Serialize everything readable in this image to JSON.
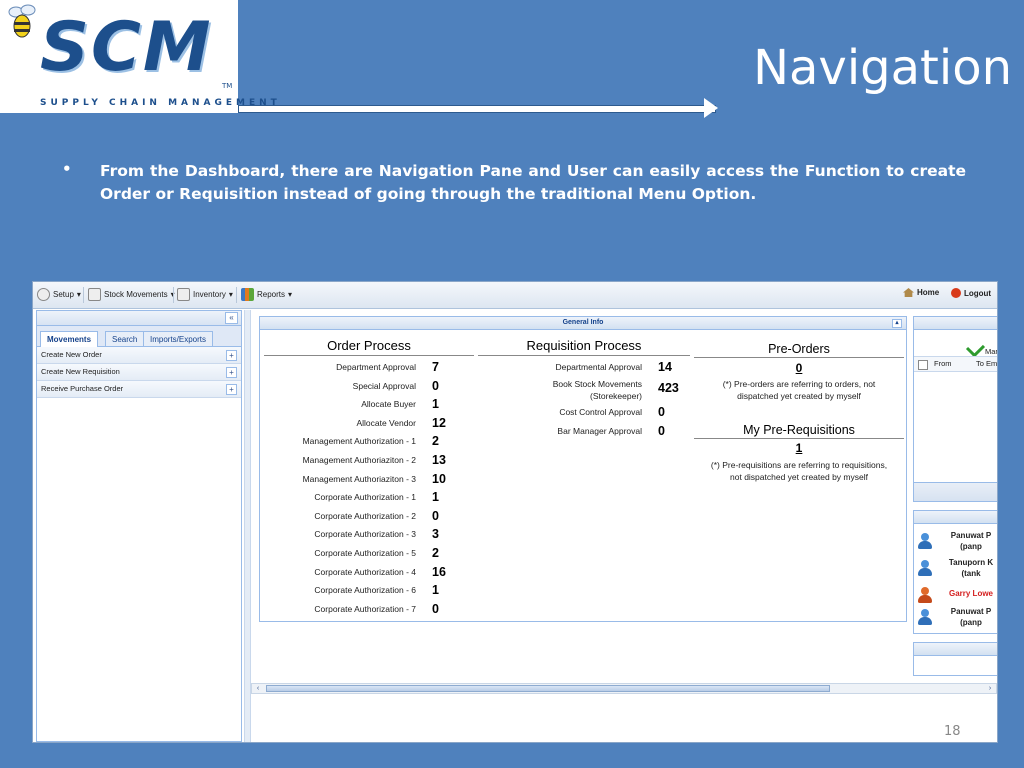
{
  "slide": {
    "title": "Navigation",
    "logo_text": "SCM",
    "logo_tagline": "SUPPLY CHAIN MANAGEMENT",
    "logo_tm": "TM",
    "bullet_mark": "•",
    "bullet_text": "From the Dashboard, there are Navigation Pane and User can easily access the Function to create Order or Requisition instead of going through the traditional Menu Option.",
    "page_number": "18"
  },
  "toolbar": {
    "setup": "Setup",
    "stock_movements": "Stock Movements",
    "inventory": "Inventory",
    "reports": "Reports",
    "home": "Home",
    "logout": "Logout",
    "dropdown_marker": "▾"
  },
  "left_pane": {
    "collapse": "«",
    "tabs": [
      "Movements",
      "Search",
      "Imports/Exports"
    ],
    "active_tab": "Movements",
    "items": [
      "Create New Order",
      "Create New Requisition",
      "Receive Purchase Order"
    ],
    "expand_glyph": "+"
  },
  "general_info": {
    "title": "General Info",
    "collapse_glyph": "▴",
    "order_process": {
      "title": "Order Process",
      "rows": [
        {
          "label": "Department Approval",
          "value": "7"
        },
        {
          "label": "Special Approval",
          "value": "0"
        },
        {
          "label": "Allocate Buyer",
          "value": "1"
        },
        {
          "label": "Allocate Vendor",
          "value": "12"
        },
        {
          "label": "Management Authorization - 1",
          "value": "2"
        },
        {
          "label": "Management Authoriaziton - 2",
          "value": "13"
        },
        {
          "label": "Management Authoriaziton - 3",
          "value": "10"
        },
        {
          "label": "Corporate Authorization - 1",
          "value": "1"
        },
        {
          "label": "Corporate Authorization - 2",
          "value": "0"
        },
        {
          "label": "Corporate Authorization - 3",
          "value": "3"
        },
        {
          "label": "Corporate Authorization - 5",
          "value": "2"
        },
        {
          "label": "Corporate Authorization - 4",
          "value": "16"
        },
        {
          "label": "Corporate Authorization - 6",
          "value": "1"
        },
        {
          "label": "Corporate Authorization - 7",
          "value": "0"
        }
      ]
    },
    "requisition_process": {
      "title": "Requisition Process",
      "rows": [
        {
          "label": "Departmental Approval",
          "value": "14"
        },
        {
          "label": "Book Stock Movements",
          "label2": "(Storekeeper)",
          "value": "423"
        },
        {
          "label": "Cost Control Approval",
          "value": "0"
        },
        {
          "label": "Bar Manager Approval",
          "value": "0"
        }
      ]
    },
    "pre_orders": {
      "title": "Pre-Orders",
      "value": "0",
      "note_line1": "(*) Pre-orders are referring to orders, not",
      "note_line2": "dispatched yet created by myself"
    },
    "pre_requisitions": {
      "title": "My Pre-Requisitions",
      "value": "1",
      "note_line1": "(*) Pre-requisitions are referring to requisitions,",
      "note_line2": "not dispatched yet created by myself"
    }
  },
  "right_panel": {
    "mar_label": "Mar",
    "col_from": "From",
    "col_to": "To Em",
    "users": [
      {
        "name": "Panuwat P",
        "sub": "(panp",
        "color": "#222222"
      },
      {
        "name": "Tanuporn K",
        "sub": "(tank",
        "color": "#222222"
      },
      {
        "name": "Garry Lowe",
        "sub": "",
        "color": "#d42020"
      },
      {
        "name": "Panuwat P",
        "sub": "(panp",
        "color": "#222222"
      }
    ]
  },
  "scrollbar": {
    "left_arrow": "‹",
    "right_arrow": "›"
  }
}
